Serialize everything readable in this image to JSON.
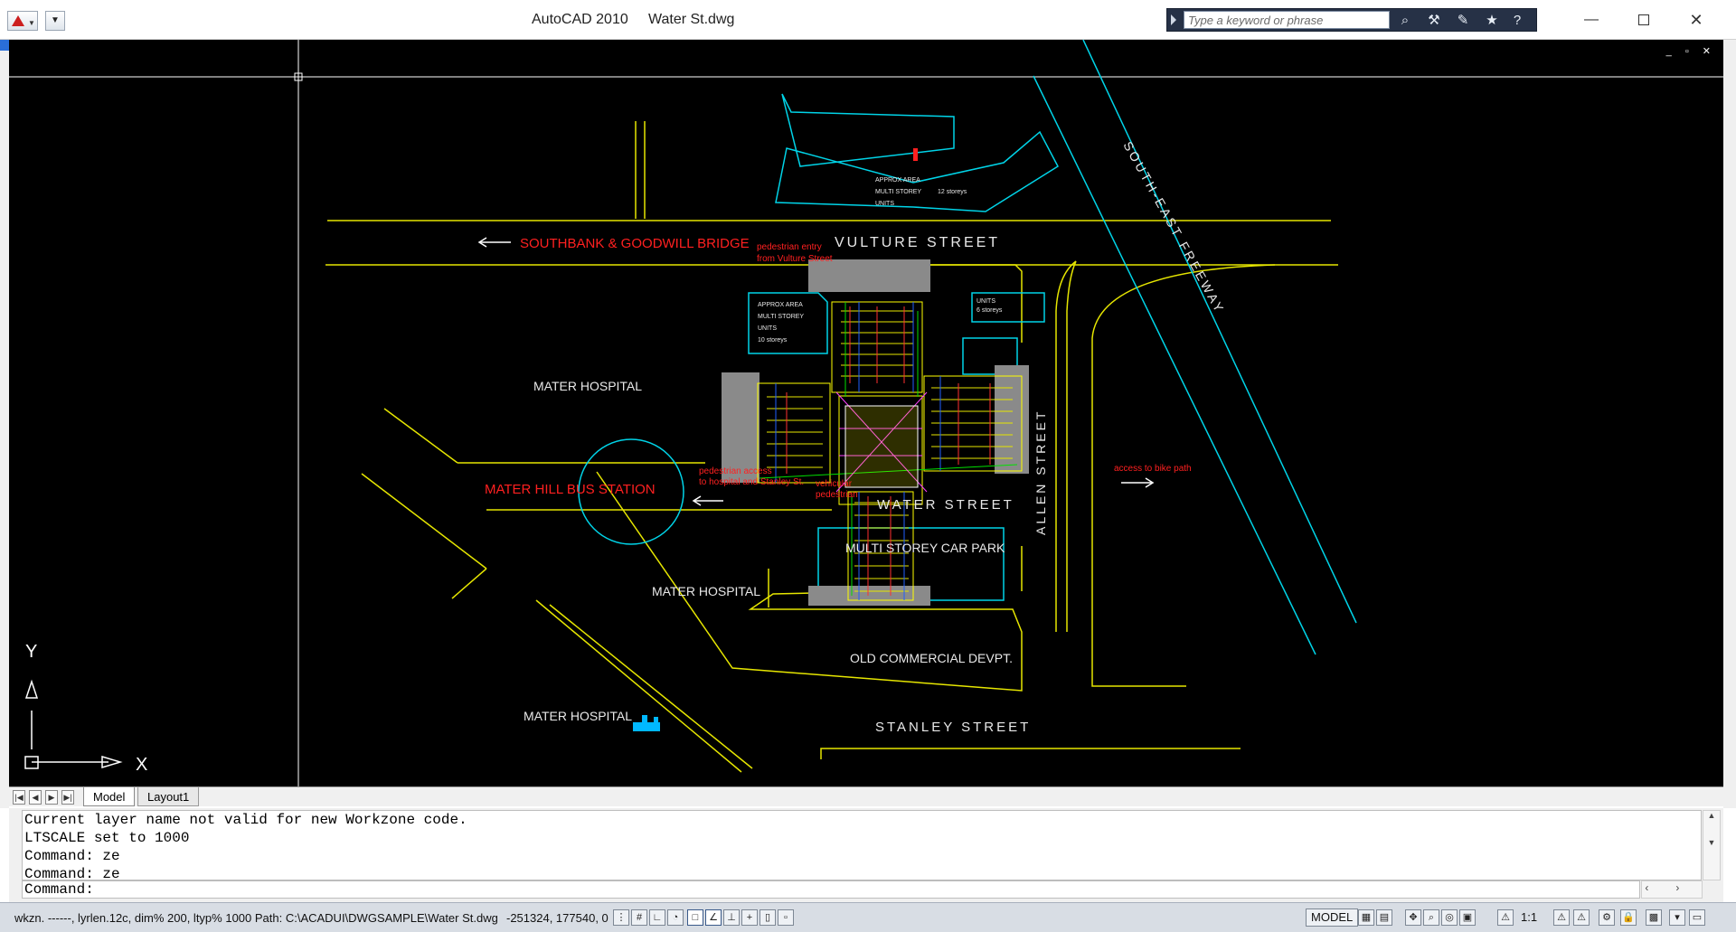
{
  "window": {
    "app_name": "AutoCAD 2010",
    "file_name": "Water St.dwg",
    "minimize": "—",
    "close": "✕"
  },
  "search": {
    "placeholder": "Type a keyword or phrase",
    "value": ""
  },
  "toolbar_icons": [
    "binoculars-icon",
    "wrench-icon",
    "tools-icon",
    "star-icon",
    "help-icon"
  ],
  "viewport": {
    "controls": "_ ▫ ✕",
    "ucs_x": "X",
    "ucs_y": "Y"
  },
  "drawing_labels": {
    "vulture_street": "VULTURE STREET",
    "southbank": "SOUTHBANK & GOODWILL BRIDGE",
    "ped_entry_1": "pedestrian entry",
    "ped_entry_2": "from Vulture Street",
    "approx_area_1": "APPROX AREA",
    "multi_storey_1": "MULTI STOREY",
    "units_1": "UNITS",
    "storeys_12": "12 storeys",
    "approx_area_2": "APPROX AREA",
    "multi_storey_2": "MULTI STOREY",
    "units_2": "UNITS",
    "storeys_10": "10 storeys",
    "units_3": "UNITS",
    "storeys_6": "6 storeys",
    "south_east_freeway": "SOUTH-EAST FREEWAY",
    "mater_hospital_1": "MATER HOSPITAL",
    "mater_hill_bus": "MATER HILL BUS STATION",
    "ped_access_1": "pedestrian access",
    "ped_access_2": "to hospital and Stanley St.",
    "vehicular_1": "vehicular",
    "vehicular_2": "pedestrian",
    "water_street": "WATER STREET",
    "allen_street": "ALLEN STREET",
    "bike_path": "access to bike path",
    "car_park": "MULTI STOREY CAR PARK",
    "mater_hospital_2": "MATER HOSPITAL",
    "old_commercial": "OLD COMMERCIAL DEVPT.",
    "stanley_street": "STANLEY STREET",
    "mater_hospital_3": "MATER HOSPITAL"
  },
  "tabs": [
    {
      "label": "Model",
      "active": true
    },
    {
      "label": "Layout1",
      "active": false
    }
  ],
  "command_line": {
    "history": [
      "Current layer name not valid for new Workzone code.",
      "LTSCALE set to 1000",
      "Command: ze",
      "Command: ze"
    ],
    "prompt": "Command:"
  },
  "status_bar": {
    "text": "wkzn. ------, lyrlen.12c, dim% 200, ltyp% 1000 Path: C:\\ACADUI\\DWGSAMPLE\\Water St.dwg",
    "coords": "-251324, 177540, 0",
    "model": "MODEL",
    "annotation_scale": "1:1"
  },
  "colors": {
    "background": "#000000",
    "roads": "#e6e600",
    "cyan": "#00d4e8",
    "red_labels": "#ff2020",
    "white_text": "#e8e8e8",
    "gray_block": "#8a8a8a",
    "search_bg": "#263146"
  }
}
